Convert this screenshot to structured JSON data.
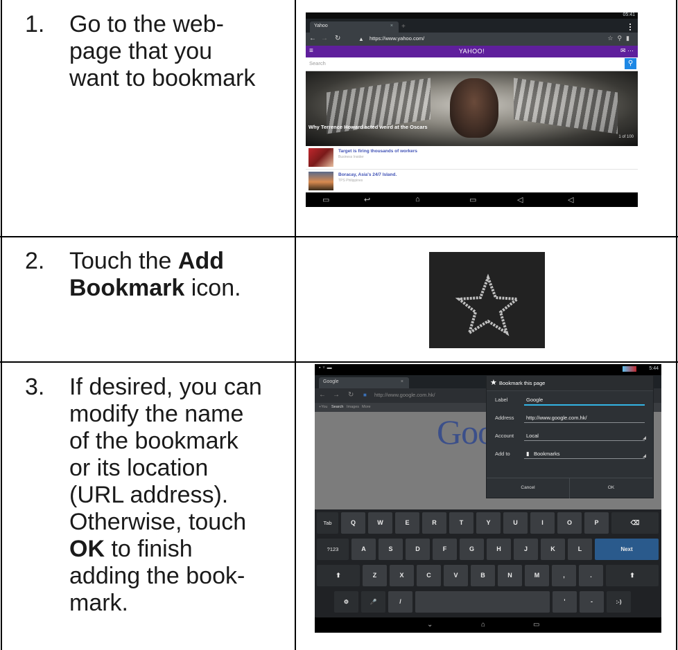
{
  "steps": [
    {
      "num": "1.",
      "lines": [
        "Go to the web-",
        "page that you",
        "want to bookmark"
      ]
    },
    {
      "num": "2.",
      "line1": "Touch the ",
      "bold1": "Add",
      "bold2": "Bookmark",
      "line2_tail": " icon."
    },
    {
      "num": "3.",
      "lines": [
        "If desired, you can",
        "modify the name",
        "of the bookmark",
        "or its location",
        "(URL address).",
        "Otherwise, touch"
      ],
      "bold": "OK",
      "tail_first": " to finish",
      "tail_lines": [
        "adding the book-",
        "mark."
      ]
    }
  ],
  "shot1": {
    "clock": "05:41",
    "tab_title": "Yahoo",
    "address": "https://www.yahoo.com/",
    "logo": "YAHOO!",
    "search_placeholder": "Search",
    "hero_caption": "Why Terrence Howard acted weird at the Oscars",
    "hero_page": "1 of 100",
    "items": [
      {
        "title": "Target is firing thousands of workers",
        "source": "Business Insider"
      },
      {
        "title": "Boracay, Asia's 24/7 Island.",
        "source": "TPS Philippines"
      }
    ]
  },
  "shot3": {
    "clock": "5:44",
    "tab_title": "Google",
    "address": "http://www.google.com.hk/",
    "subnav": [
      "+You",
      "Search",
      "Images",
      "More"
    ],
    "logo": "Goo",
    "dialog": {
      "title": "Bookmark this page",
      "label_key": "Label",
      "label_value": "Google",
      "address_key": "Address",
      "address_value": "http://www.google.com.hk/",
      "account_key": "Account",
      "account_value": "Local",
      "addto_key": "Add to",
      "addto_value": "Bookmarks",
      "cancel": "Cancel",
      "ok": "OK"
    },
    "keyboard": {
      "row1": [
        "Tab",
        "Q",
        "W",
        "E",
        "R",
        "T",
        "Y",
        "U",
        "I",
        "O",
        "P",
        "⌫"
      ],
      "row2": [
        "?123",
        "A",
        "S",
        "D",
        "F",
        "G",
        "H",
        "J",
        "K",
        "L",
        "Next"
      ],
      "row3": [
        "⬆",
        "Z",
        "X",
        "C",
        "V",
        "B",
        "N",
        "M",
        ",",
        ".",
        "⬆"
      ],
      "row4": [
        "⚙",
        "🎤",
        "/",
        "",
        "'",
        "-",
        ":-)"
      ]
    }
  },
  "colors": {
    "yahoo_purple": "#5f1f9c",
    "google_blue": "#3b4f8a",
    "key_next": "#2a5a8c"
  }
}
